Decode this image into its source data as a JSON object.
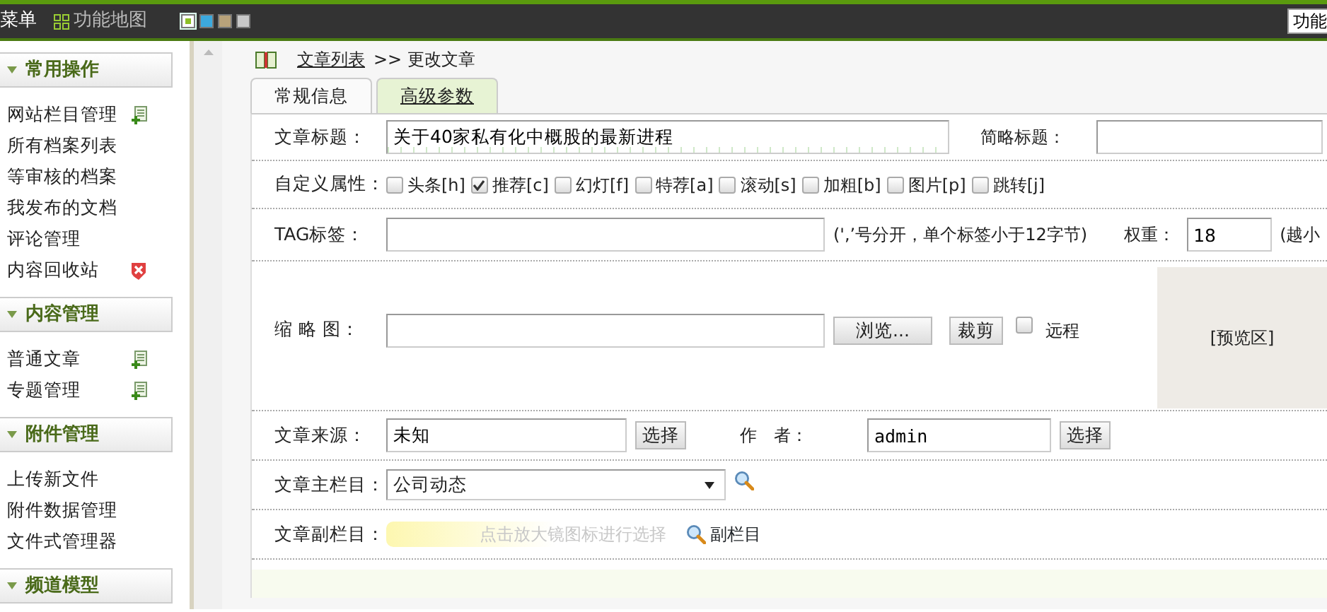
{
  "top_bar": {
    "menu_label": "菜单",
    "map_label": "功能地图",
    "themes": [
      {
        "color": "#8cbf26",
        "selected": true
      },
      {
        "color": "#3ca9de",
        "selected": false
      },
      {
        "color": "#b8a27a",
        "selected": false
      },
      {
        "color": "#c8c8c8",
        "selected": false
      }
    ],
    "right_button": "功能"
  },
  "sidebar": {
    "groups": [
      {
        "title": "常用操作",
        "expanded": true,
        "items": [
          {
            "label": "网站栏目管理",
            "kind": "add"
          },
          {
            "label": "所有档案列表",
            "kind": "plain"
          },
          {
            "label": "等审核的档案",
            "kind": "plain"
          },
          {
            "label": "我发布的文档",
            "kind": "plain"
          },
          {
            "label": "评论管理",
            "kind": "plain"
          },
          {
            "label": "内容回收站",
            "kind": "delete"
          }
        ]
      },
      {
        "title": "内容管理",
        "expanded": true,
        "items": [
          {
            "label": "普通文章",
            "kind": "add"
          },
          {
            "label": "专题管理",
            "kind": "add"
          }
        ]
      },
      {
        "title": "附件管理",
        "expanded": true,
        "items": [
          {
            "label": "上传新文件",
            "kind": "plain"
          },
          {
            "label": "附件数据管理",
            "kind": "plain"
          },
          {
            "label": "文件式管理器",
            "kind": "plain"
          }
        ]
      },
      {
        "title": "频道模型",
        "expanded": true
      }
    ]
  },
  "breadcrumb": {
    "link": "文章列表",
    "separator": ">>",
    "current": "更改文章"
  },
  "tabs": [
    {
      "label": "常规信息",
      "selected": false
    },
    {
      "label": "高级参数",
      "selected": true
    }
  ],
  "form": {
    "title_row": {
      "label": "文章标题：",
      "value": "关于40家私有化中概股的最新进程",
      "short_label": "简略标题："
    },
    "attributes": {
      "label": "自定义属性：",
      "options": [
        {
          "label": "头条[h]",
          "checked": false
        },
        {
          "label": "推荐[c]",
          "checked": true
        },
        {
          "label": "幻灯[f]",
          "checked": false
        },
        {
          "label": "特荐[a]",
          "checked": false
        },
        {
          "label": "滚动[s]",
          "checked": false
        },
        {
          "label": "加粗[b]",
          "checked": false
        },
        {
          "label": "图片[p]",
          "checked": false
        },
        {
          "label": "跳转[j]",
          "checked": false
        }
      ]
    },
    "tag_row": {
      "label": "TAG标签：",
      "hint": "(',’号分开，单个标签小于12字节)",
      "weight_label": "权重：",
      "weight_value": "18",
      "weight_hint": "(越小"
    },
    "thumb_row": {
      "label": "缩 略 图：",
      "browse_button": "浏览...",
      "crop_button": "裁剪",
      "remote_label": "远程",
      "remote_checked": false,
      "preview": "[预览区]"
    },
    "source_row": {
      "label": "文章来源：",
      "value": "未知",
      "source_button": "选择",
      "author_label": "作　者：",
      "author_value": "admin",
      "author_button": "选择"
    },
    "main_column": {
      "label": "文章主栏目：",
      "value": "公司动态"
    },
    "sub_column": {
      "label": "文章副栏目：",
      "placeholder": "点击放大镜图标进行选择",
      "link": "副栏目"
    }
  }
}
